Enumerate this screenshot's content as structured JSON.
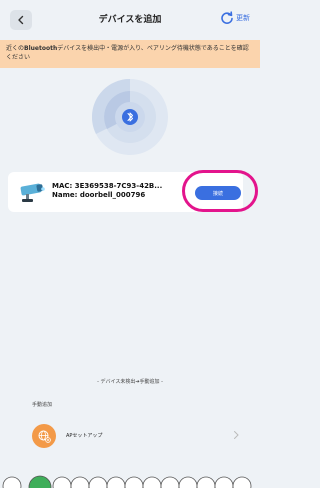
{
  "header": {
    "title": "デバイスを追加",
    "refresh_label": "更新",
    "back_icon": "chevron-left-icon",
    "refresh_icon": "refresh-icon",
    "accent": "#3a6fe0"
  },
  "banner": {
    "prefix": "近くの",
    "bold": "Bluetooth",
    "text": "デバイスを検出中・電源が入り、ペアリング待機状態であることを確認ください",
    "color": "#fbd4ad"
  },
  "radar": {
    "icon": "bluetooth-icon"
  },
  "device": {
    "mac_line": "MAC: 3E369538-7C93-42B...",
    "name_line": "Name: doorbell_000796",
    "icon": "camera-icon",
    "action_label": "接続"
  },
  "hint": "- デバイス未検出➔手動追加 -",
  "manual": {
    "title": "手動追加",
    "items": [
      {
        "label": "APセットアップ",
        "icon": "globe-add-icon"
      }
    ]
  },
  "highlight_color": "#e3148c"
}
